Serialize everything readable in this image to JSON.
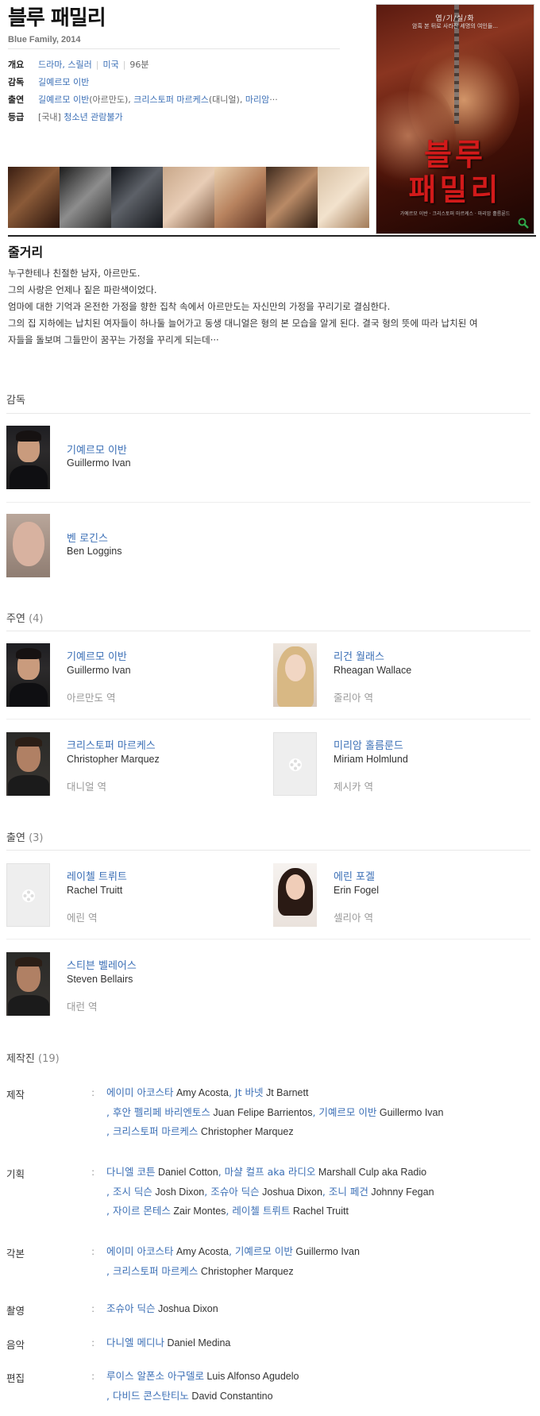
{
  "header": {
    "title": "블루 패밀리",
    "subtitle": "Blue Family, 2014"
  },
  "info": {
    "overview_label": "개요",
    "genre": "드라마, 스릴러",
    "country": "미국",
    "runtime": "96분",
    "director_label": "감독",
    "director": "길예르모 이반",
    "cast_label": "출연",
    "cast_1": "길예르모 이반",
    "cast_1_role": "(아르만도)",
    "cast_2": "크리스토퍼 마르케스",
    "cast_2_role": "(대니얼)",
    "cast_3": "마리암",
    "cast_more": "···",
    "rating_label": "등급",
    "rating_region": "[국내]",
    "rating": "청소년 관람불가"
  },
  "poster": {
    "tag": "엽/기/실/화",
    "sub": "암흑 본 뒤로 사라진 세명의 여인들...",
    "title_1": "블루",
    "title_2": "패밀리",
    "small": "가예르모 이반 · 크리스토퍼 마르케스 · 마리암 홀름룬드"
  },
  "synopsis": {
    "title": "줄거리",
    "lines": [
      "누구한테나 친절한 남자, 아르만도.",
      " 그의 사랑은 언제나 짙은 파란색이었다.",
      " 엄마에 대한 기억과 온전한 가정을 향한 집착 속에서 아르만도는 자신만의 가정을 꾸리기로 결심한다.",
      " 그의 집 지하에는 납치된 여자들이 하나둘 늘어가고 동생 대니얼은 형의 본 모습을 알게 된다. 결국 형의 뜻에 따라 납치된 여",
      " 자들을 돌보며 그들만이 꿈꾸는 가정을 꾸리게 되는데···"
    ]
  },
  "sections": {
    "directors": {
      "title": "감독"
    },
    "leads": {
      "title": "주연",
      "count": "(4)"
    },
    "supporting": {
      "title": "출연",
      "count": "(3)"
    },
    "crew": {
      "title": "제작진",
      "count": "(19)"
    }
  },
  "directors": [
    {
      "name": "기예르모 이반",
      "ename": "Guillermo Ivan"
    },
    {
      "name": "벤 로긴스",
      "ename": "Ben Loggins"
    }
  ],
  "leads": [
    {
      "name": "기예르모 이반",
      "ename": "Guillermo Ivan",
      "role": "아르만도 역"
    },
    {
      "name": "리건 월래스",
      "ename": "Rheagan Wallace",
      "role": "줄리아 역"
    },
    {
      "name": "크리스토퍼 마르케스",
      "ename": "Christopher Marquez",
      "role": "대니얼 역"
    },
    {
      "name": "미리암 홀름룬드",
      "ename": "Miriam Holmlund",
      "role": "제시카 역"
    }
  ],
  "supporting": [
    {
      "name": "레이첼 트뤼트",
      "ename": "Rachel Truitt",
      "role": "에린 역"
    },
    {
      "name": "에린 포겔",
      "ename": "Erin Fogel",
      "role": "셀리아 역"
    },
    {
      "name": "스티븐 벨레어스",
      "ename": "Steven Bellairs",
      "role": "대런 역"
    }
  ],
  "crew": {
    "colon": ":",
    "production": {
      "label": "제작",
      "p1k": "에이미 아코스타",
      "p1e": " Amy Acosta",
      "p2k": "Jt 바넷",
      "p2e": " Jt Barnett",
      "p3k": "후안 펠리페 바리엔토스",
      "p3e": " Juan Felipe Barrientos",
      "p4k": "기예르모 이반",
      "p4e": " Guillermo Ivan",
      "p5k": "크리스토퍼 마르케스",
      "p5e": " Christopher Marquez"
    },
    "planning": {
      "label": "기획",
      "p1k": "다니엘 코튼",
      "p1e": " Daniel Cotton",
      "p2k": "마샬 컬프 aka 라디오",
      "p2e": " Marshall Culp aka Radio",
      "p3k": "조시 딕슨",
      "p3e": " Josh Dixon",
      "p4k": "조슈아 딕슨",
      "p4e": " Joshua Dixon",
      "p5k": "조니 페건",
      "p5e": " Johnny Fegan",
      "p6k": "자이르 몬테스",
      "p6e": " Zair Montes",
      "p7k": "레이첼 트뤼트",
      "p7e": " Rachel Truitt"
    },
    "screenplay": {
      "label": "각본",
      "p1k": "에이미 아코스타",
      "p1e": " Amy Acosta",
      "p2k": "기예르모 이반",
      "p2e": " Guillermo Ivan",
      "p3k": "크리스토퍼 마르케스",
      "p3e": " Christopher Marquez"
    },
    "cinematography": {
      "label": "촬영",
      "p1k": "조슈아 딕슨",
      "p1e": " Joshua Dixon"
    },
    "music": {
      "label": "음악",
      "p1k": "다니엘 메디나",
      "p1e": " Daniel Medina"
    },
    "editing": {
      "label": "편집",
      "p1k": "루이스 알폰소 아구델로",
      "p1e": " Luis Alfonso Agudelo",
      "p2k": "다비드 콘스탄티노",
      "p2e": " David Constantino"
    }
  }
}
